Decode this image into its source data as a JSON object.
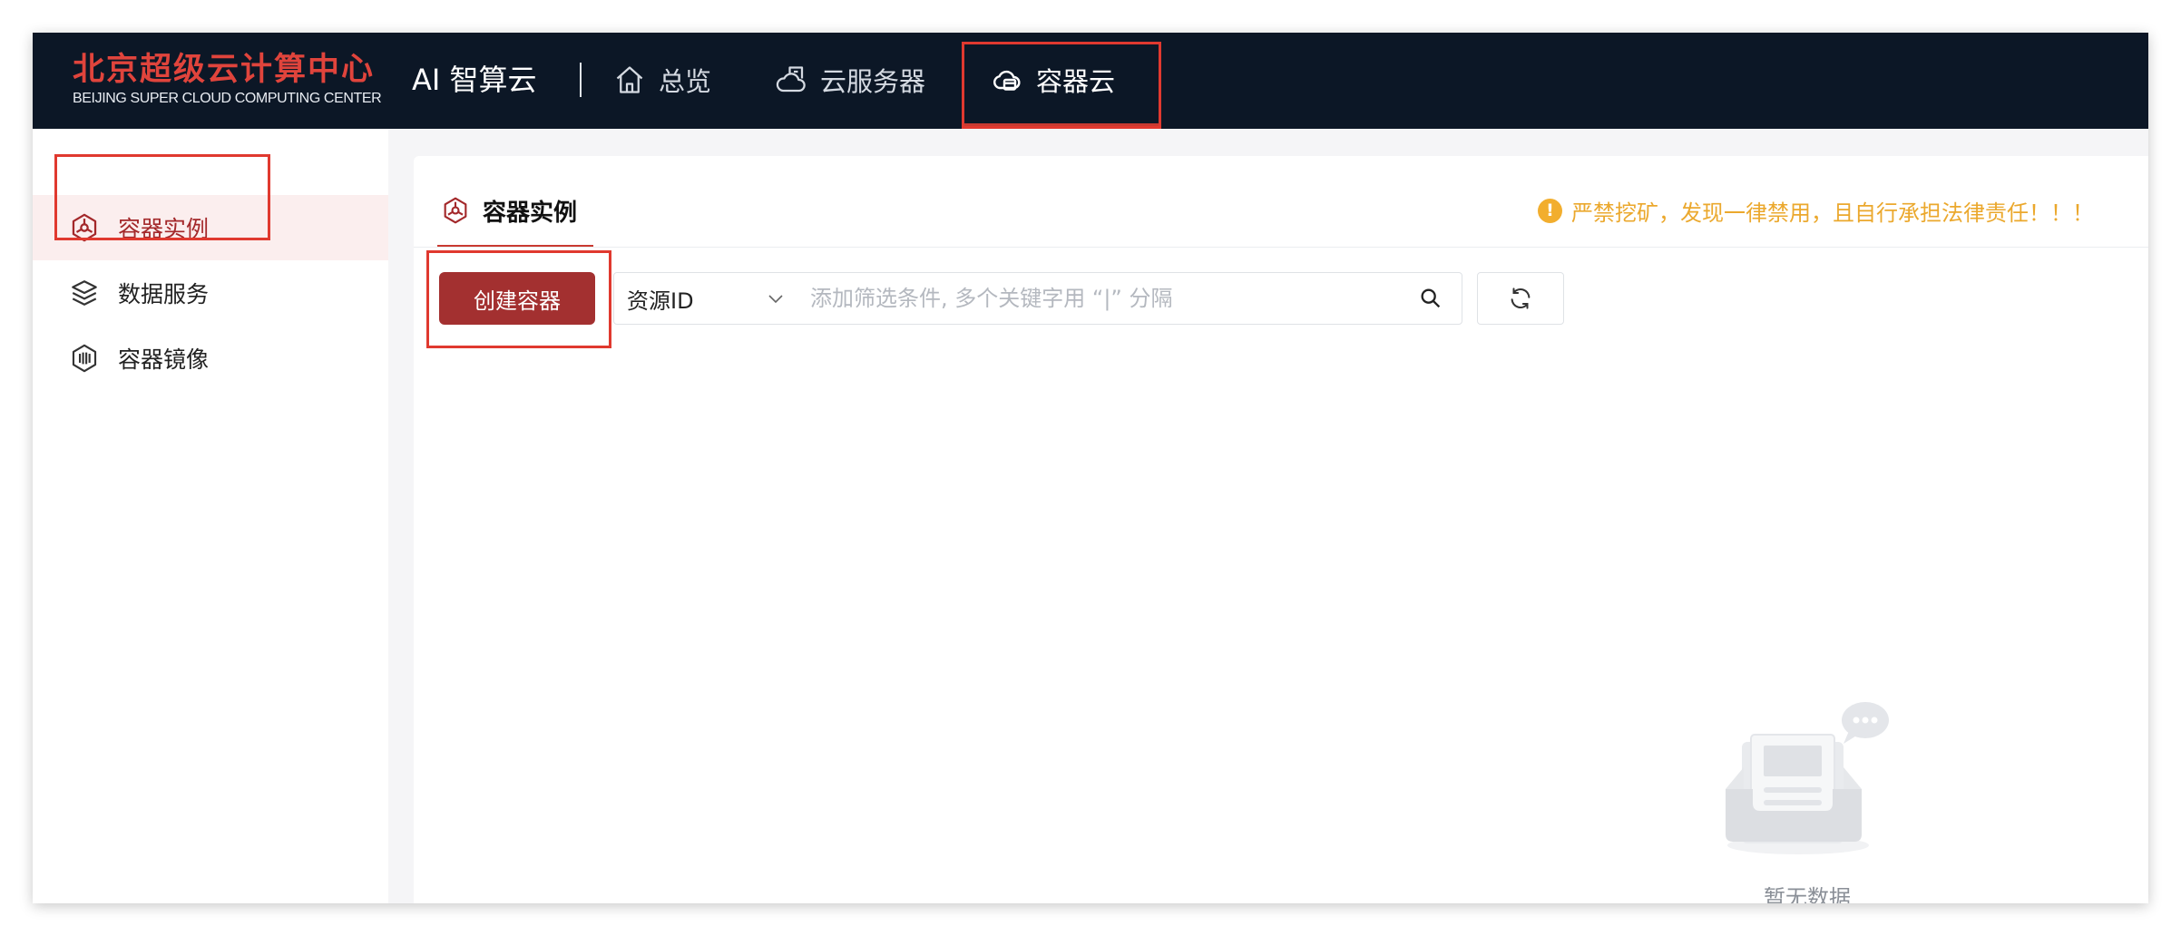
{
  "header": {
    "logo_cn": "北京超级云计算中心",
    "logo_en": "BEIJING SUPER CLOUD COMPUTING CENTER",
    "product": "AI 智算云",
    "nav": [
      {
        "label": "总览",
        "icon": "home-icon"
      },
      {
        "label": "云服务器",
        "icon": "cloud-server-icon"
      },
      {
        "label": "容器云",
        "icon": "container-cloud-icon",
        "active": true
      }
    ]
  },
  "sidebar": {
    "items": [
      {
        "label": "容器实例",
        "icon": "container-instance-icon",
        "active": true
      },
      {
        "label": "数据服务",
        "icon": "data-layers-icon"
      },
      {
        "label": "容器镜像",
        "icon": "container-image-icon"
      }
    ]
  },
  "main": {
    "tab_label": "容器实例",
    "warning": "严禁挖矿，发现一律禁用，且自行承担法律责任！！！",
    "create_button": "创建容器",
    "filter": {
      "select_value": "资源ID",
      "placeholder": "添加筛选条件, 多个关键字用 “|” 分隔"
    },
    "empty_text": "暂无数据"
  },
  "colors": {
    "header_bg": "#0c1726",
    "brand_red": "#a33030",
    "logo_red": "#e0443c",
    "warning": "#eba82d",
    "highlight": "#e0392f"
  }
}
